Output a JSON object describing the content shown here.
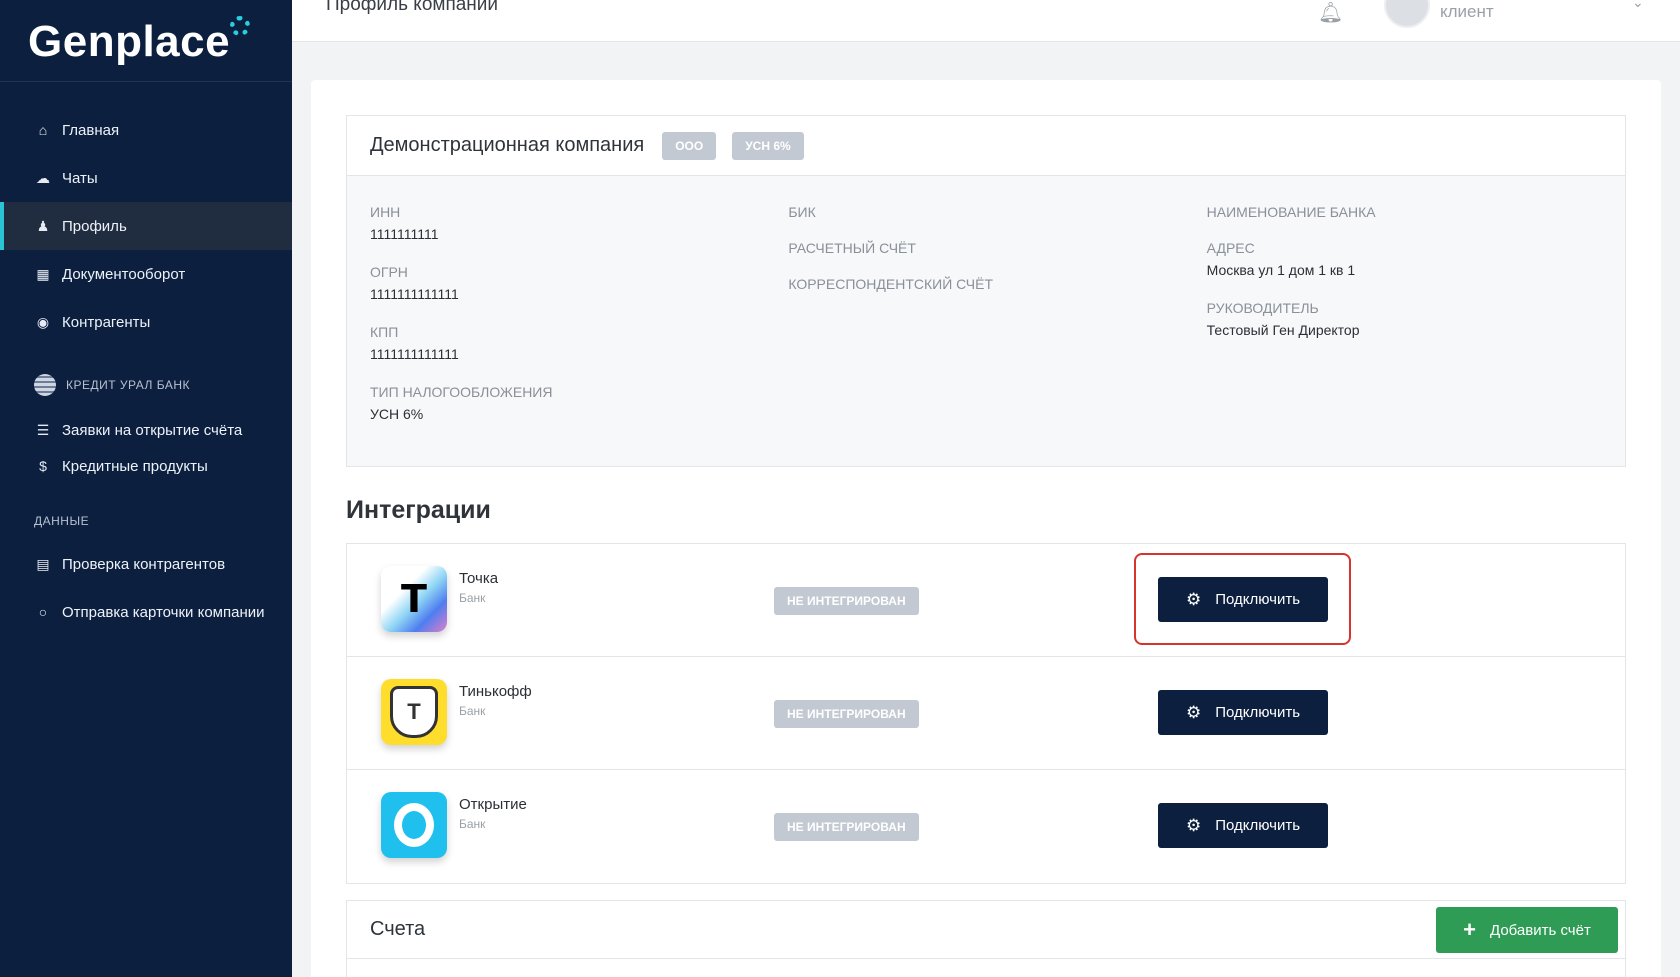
{
  "app": {
    "logo_text": "Genplace"
  },
  "topbar": {
    "page_title": "Профиль компании",
    "user_role": "клиент"
  },
  "sidebar": {
    "items": [
      {
        "label": "Главная",
        "icon": "home-icon"
      },
      {
        "label": "Чаты",
        "icon": "chat-icon"
      },
      {
        "label": "Профиль",
        "icon": "profile-icon",
        "active": true
      },
      {
        "label": "Документооборот",
        "icon": "documents-icon"
      },
      {
        "label": "Контрагенты",
        "icon": "target-icon"
      }
    ],
    "bank_section": "КРЕДИТ УРАЛ БАНК",
    "bank_items": [
      {
        "label": "Заявки на открытие счёта",
        "icon": "list-icon"
      },
      {
        "label": "Кредитные продукты",
        "icon": "dollar-icon"
      }
    ],
    "data_section": "ДАННЫЕ",
    "data_items": [
      {
        "label": "Проверка контрагентов",
        "icon": "card-icon"
      },
      {
        "label": "Отправка карточки компании",
        "icon": "circle-icon"
      }
    ]
  },
  "company": {
    "name": "Демонстрационная компания",
    "tags": [
      "ООО",
      "УСН 6%"
    ],
    "fields": {
      "inn_label": "ИНН",
      "inn": "1111111111",
      "ogrn_label": "ОГРН",
      "ogrn": "1111111111111",
      "kpp_label": "КПП",
      "kpp": "1111111111111",
      "tax_label": "ТИП НАЛОГООБЛОЖЕНИЯ",
      "tax": "УСН 6%",
      "bik_label": "БИК",
      "account_label": "РАСЧЕТНЫЙ СЧЁТ",
      "corr_label": "КОРРЕСПОНДЕНТСКИЙ СЧЁТ",
      "bank_name_label": "НАИМЕНОВАНИЕ БАНКА",
      "address_label": "АДРЕС",
      "address": "Москва ул 1 дом 1 кв 1",
      "director_label": "РУКОВОДИТЕЛЬ",
      "director": "Тестовый Ген Директор"
    }
  },
  "integrations": {
    "title": "Интеграции",
    "rows": [
      {
        "name": "Точка",
        "type": "Банк",
        "status": "НЕ ИНТЕГРИРОВАН",
        "button": "Подключить",
        "icon_letter": "Т"
      },
      {
        "name": "Тинькофф",
        "type": "Банк",
        "status": "НЕ ИНТЕГРИРОВАН",
        "button": "Подключить",
        "icon_letter": "Т"
      },
      {
        "name": "Открытие",
        "type": "Банк",
        "status": "НЕ ИНТЕГРИРОВАН",
        "button": "Подключить"
      }
    ]
  },
  "accounts": {
    "title": "Счета",
    "add_button": "Добавить счёт"
  },
  "colors": {
    "sidebar_bg": "#0c1f3f",
    "accent": "#2bc3d6",
    "highlight": "#d6342c",
    "add_button": "#2e9c55"
  }
}
